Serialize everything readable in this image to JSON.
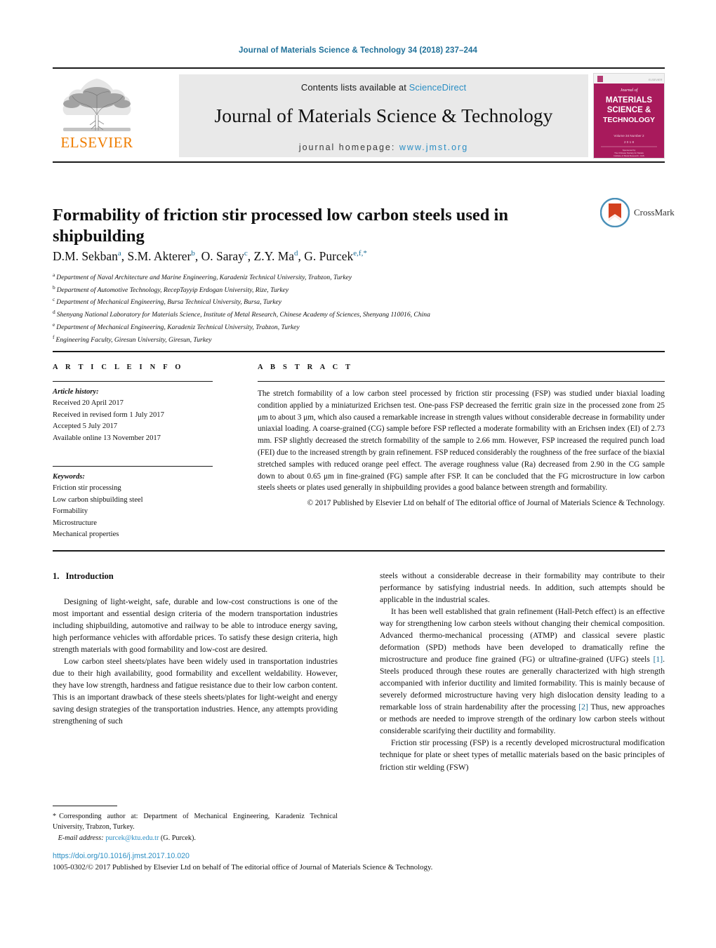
{
  "running_head": "Journal of Materials Science & Technology 34 (2018) 237–244",
  "masthead": {
    "contents_prefix": "Contents lists available at ",
    "sciencedirect": "ScienceDirect",
    "journal_name": "Journal of Materials Science & Technology",
    "homepage_prefix": "journal homepage: ",
    "homepage_url": "www.jmst.org",
    "publisher_logo_text": "ELSEVIER",
    "publisher_logo_color": "#ef7d00",
    "link_color": "#2b8ec4",
    "cover": {
      "line1": "Journal of",
      "line2": "MATERIALS",
      "line3": "SCIENCE &",
      "line4": "TECHNOLOGY",
      "volume_line": "Volume 34  Number 2",
      "year_line": "2 0 1 8",
      "background": "#a81a5c"
    }
  },
  "article": {
    "title": "Formability of friction stir processed low carbon steels used in shipbuilding",
    "crossmark_label": "CrossMark",
    "authors_html": "D.M. Sekban<sup>a</sup>, S.M. Akterer<sup>b</sup>, O. Saray<sup>c</sup>, Z.Y. Ma<sup>d</sup>, G. Purcek<sup>e,f,</sup><sup class=\"star\">*</sup>",
    "affiliations": [
      {
        "mark": "a",
        "text": "Department of Naval Architecture and Marine Engineering, Karadeniz Technical University, Trabzon, Turkey"
      },
      {
        "mark": "b",
        "text": "Department of Automotive Technology, RecepTayyip Erdogan University, Rize, Turkey"
      },
      {
        "mark": "c",
        "text": "Department of Mechanical Engineering, Bursa Technical University, Bursa, Turkey"
      },
      {
        "mark": "d",
        "text": "Shenyang National Laboratory for Materials Science, Institute of Metal Research, Chinese Academy of Sciences, Shenyang 110016, China"
      },
      {
        "mark": "e",
        "text": "Department of Mechanical Engineering, Karadeniz Technical University, Trabzon, Turkey"
      },
      {
        "mark": "f",
        "text": "Engineering Faculty, Giresun University, Giresun, Turkey"
      }
    ]
  },
  "article_info": {
    "heading": "A R T I C L E   I N F O",
    "history_label": "Article history:",
    "history": [
      "Received 20 April 2017",
      "Received in revised form 1 July 2017",
      "Accepted 5 July 2017",
      "Available online 13 November 2017"
    ],
    "keywords_label": "Keywords:",
    "keywords": [
      "Friction stir processing",
      "Low carbon shipbuilding steel",
      "Formability",
      "Microstructure",
      "Mechanical properties"
    ]
  },
  "abstract": {
    "heading": "A B S T R A C T",
    "text": "The stretch formability of a low carbon steel processed by friction stir processing (FSP) was studied under biaxial loading condition applied by a miniaturized Erichsen test. One-pass FSP decreased the ferritic grain size in the processed zone from 25 μm to about 3 μm, which also caused a remarkable increase in strength values without considerable decrease in formability under uniaxial loading. A coarse-grained (CG) sample before FSP reflected a moderate formability with an Erichsen index (EI) of 2.73 mm. FSP slightly decreased the stretch formability of the sample to 2.66 mm. However, FSP increased the required punch load (FEI) due to the increased strength by grain refinement. FSP reduced considerably the roughness of the free surface of the biaxial stretched samples with reduced orange peel effect. The average roughness value (Ra) decreased from 2.90 in the CG sample down to about 0.65 μm in fine-grained (FG) sample after FSP. It can be concluded that the FG microstructure in low carbon steels sheets or plates used generally in shipbuilding provides a good balance between strength and formability.",
    "copyright": "© 2017 Published by Elsevier Ltd on behalf of The editorial office of Journal of Materials Science & Technology."
  },
  "body": {
    "section_number": "1.",
    "section_title": "Introduction",
    "left_paragraphs": [
      "Designing of light-weight, safe, durable and low-cost constructions is one of the most important and essential design criteria of the modern transportation industries including shipbuilding, automotive and railway to be able to introduce energy saving, high performance vehicles with affordable prices. To satisfy these design criteria, high strength materials with good formability and low-cost are desired.",
      "Low carbon steel sheets/plates have been widely used in transportation industries due to their high availability, good formability and excellent weldability. However, they have low strength, hardness and fatigue resistance due to their low carbon content. This is an important drawback of these steels sheets/plates for light-weight and energy saving design strategies of the transportation industries. Hence, any attempts providing strengthening of such"
    ],
    "right_paragraphs": [
      {
        "text_parts": [
          {
            "t": "steels without a considerable decrease in their formability may contribute to their performance by satisfying industrial needs. In addition, such attempts should be applicable in the industrial scales."
          }
        ],
        "indent": false
      },
      {
        "text_parts": [
          {
            "t": "It has been well established that grain refinement (Hall-Petch effect) is an effective way for strengthening low carbon steels without changing their chemical composition. Advanced thermo-mechanical processing (ATMP) and classical severe plastic deformation (SPD) methods have been developed to dramatically refine the microstructure and produce fine grained (FG) or ultrafine-grained (UFG) steels "
          },
          {
            "t": "[1]",
            "ref": true
          },
          {
            "t": ". Steels produced through these routes are generally characterized with high strength accompanied with inferior ductility and limited formability. This is mainly because of severely deformed microstructure having very high dislocation density leading to a remarkable loss of strain hardenability after the processing "
          },
          {
            "t": "[2]",
            "ref": true
          },
          {
            "t": " Thus, new approaches or methods are needed to improve strength of the ordinary low carbon steels without considerable scarifying their ductility and formability."
          }
        ],
        "indent": true
      },
      {
        "text_parts": [
          {
            "t": "Friction stir processing (FSP) is a recently developed microstructural modification technique for plate or sheet types of metallic materials based on the basic principles of friction stir welding (FSW)"
          }
        ],
        "indent": true
      }
    ]
  },
  "footer": {
    "corresponding_star": "*",
    "corresponding_text": "Corresponding author at: Department of Mechanical Engineering, Karadeniz Technical University, Trabzon, Turkey.",
    "email_label": "E-mail address:",
    "email": "purcek@ktu.edu.tr",
    "email_suffix": "(G. Purcek).",
    "doi": "https://doi.org/10.1016/j.jmst.2017.10.020",
    "imprint": "1005-0302/© 2017 Published by Elsevier Ltd on behalf of The editorial office of Journal of Materials Science & Technology."
  }
}
